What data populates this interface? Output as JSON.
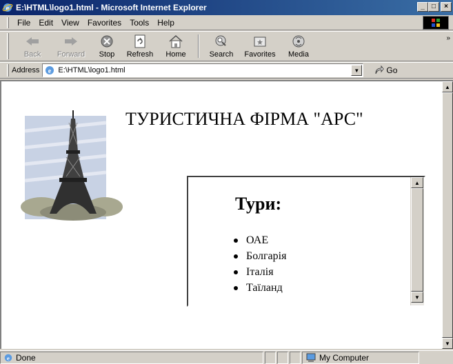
{
  "window": {
    "title": "E:\\HTML\\logo1.html - Microsoft Internet Explorer",
    "controls": [
      "minimize",
      "maximize",
      "close"
    ]
  },
  "menu": {
    "items": [
      {
        "label": "File",
        "accel": "F"
      },
      {
        "label": "Edit",
        "accel": "E"
      },
      {
        "label": "View",
        "accel": "V"
      },
      {
        "label": "Favorites",
        "accel": "a"
      },
      {
        "label": "Tools",
        "accel": "T"
      },
      {
        "label": "Help",
        "accel": "H"
      }
    ]
  },
  "toolbar": {
    "back": "Back",
    "forward": "Forward",
    "stop": "Stop",
    "refresh": "Refresh",
    "home": "Home",
    "search": "Search",
    "favorites": "Favorites",
    "media": "Media",
    "more": "»"
  },
  "address": {
    "label": "Address",
    "url": "E:\\HTML\\logo1.html",
    "go": "Go"
  },
  "page": {
    "heading": "ТУРИСТИЧНА ФІРМА \"АРС\"",
    "frame": {
      "title": "Тури:",
      "items": [
        "ОАЕ",
        "Болгарія",
        "Італія",
        "Таїланд"
      ]
    }
  },
  "status": {
    "text": "Done",
    "zone": "My Computer"
  },
  "colors": {
    "titlebar_start": "#0a246a",
    "titlebar_end": "#3a6ea5",
    "chrome": "#d4d0c8"
  }
}
